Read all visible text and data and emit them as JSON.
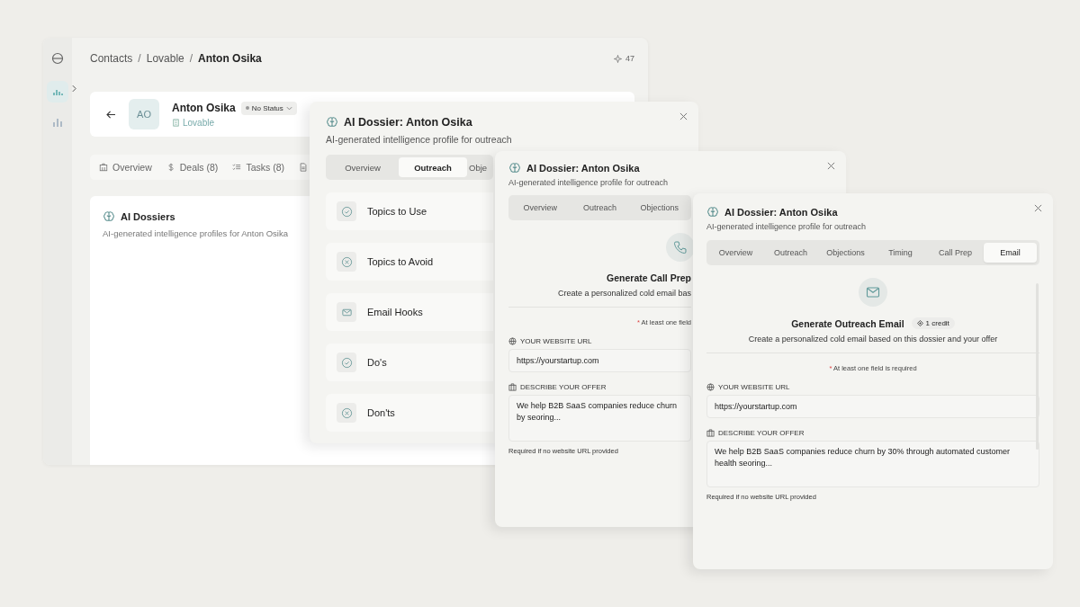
{
  "sidebar": {
    "items": [
      {
        "kind": "activity",
        "selected": true
      },
      {
        "kind": "bars",
        "selected": false
      }
    ]
  },
  "breadcrumb": [
    "Contacts",
    "Lovable",
    "Anton Osika"
  ],
  "breadcrumb_separator": "/",
  "credits": "47",
  "contact": {
    "initials": "AO",
    "name": "Anton Osika",
    "status": "No Status",
    "company": "Lovable"
  },
  "contact_tabs": [
    {
      "kind": "overview",
      "label": "Overview"
    },
    {
      "kind": "deals",
      "label": "Deals (8)"
    },
    {
      "kind": "tasks",
      "label": "Tasks (8)"
    },
    {
      "kind": "document"
    }
  ],
  "dossiers_card": {
    "title": "AI Dossiers",
    "subtitle": "AI-generated intelligence profiles for Anton Osika"
  },
  "panels": [
    {
      "kind": "sections",
      "title": "AI Dossier: Anton Osika",
      "subtitle": "AI-generated intelligence profile for outreach",
      "tabs": [
        {
          "label": "Overview",
          "selected": false
        },
        {
          "label": "Outreach",
          "selected": true
        },
        {
          "label": "Obje",
          "selected": false
        }
      ],
      "sections": [
        {
          "kind": "check",
          "label": "Topics to Use"
        },
        {
          "kind": "cross",
          "label": "Topics to Avoid"
        },
        {
          "kind": "mail",
          "label": "Email Hooks"
        },
        {
          "kind": "check",
          "label": "Do's"
        },
        {
          "kind": "cross",
          "label": "Don'ts"
        }
      ]
    },
    {
      "kind": "generate",
      "title": "AI Dossier: Anton Osika",
      "subtitle": "AI-generated intelligence profile for outreach",
      "tabs": [
        {
          "label": "Overview",
          "selected": false
        },
        {
          "label": "Outreach",
          "selected": false
        },
        {
          "label": "Objections",
          "selected": false
        }
      ],
      "heading": "Generate Call Prep",
      "description": "Create a personalized cold email bas",
      "required_mark": "*",
      "required_note": "At least one field",
      "url_label": "YOUR WEBSITE URL",
      "url_value": "https://yourstartup.com",
      "offer_label": "DESCRIBE YOUR OFFER",
      "offer_value": "We help B2B SaaS companies reduce churn by seoring...",
      "helper": "Required if no website URL provided"
    },
    {
      "kind": "generate",
      "title": "AI Dossier: Anton Osika",
      "subtitle": "AI-generated intelligence profile for outreach",
      "tabs": [
        {
          "label": "Overview",
          "selected": false
        },
        {
          "label": "Outreach",
          "selected": false
        },
        {
          "label": "Objections",
          "selected": false
        },
        {
          "label": "Timing",
          "selected": false
        },
        {
          "label": "Call Prep",
          "selected": false
        },
        {
          "label": "Email",
          "selected": true
        }
      ],
      "heading": "Generate Outreach Email",
      "credit": "1 credit",
      "description": "Create a personalized cold email based on this dossier and your offer",
      "required_mark": "*",
      "required_note": "At least one field is required",
      "url_label": "YOUR WEBSITE URL",
      "url_value": "https://yourstartup.com",
      "offer_label": "DESCRIBE YOUR OFFER",
      "offer_value": "We help B2B SaaS companies reduce churn by 30% through automated customer health seoring...",
      "helper": "Required if no website URL provided"
    }
  ]
}
